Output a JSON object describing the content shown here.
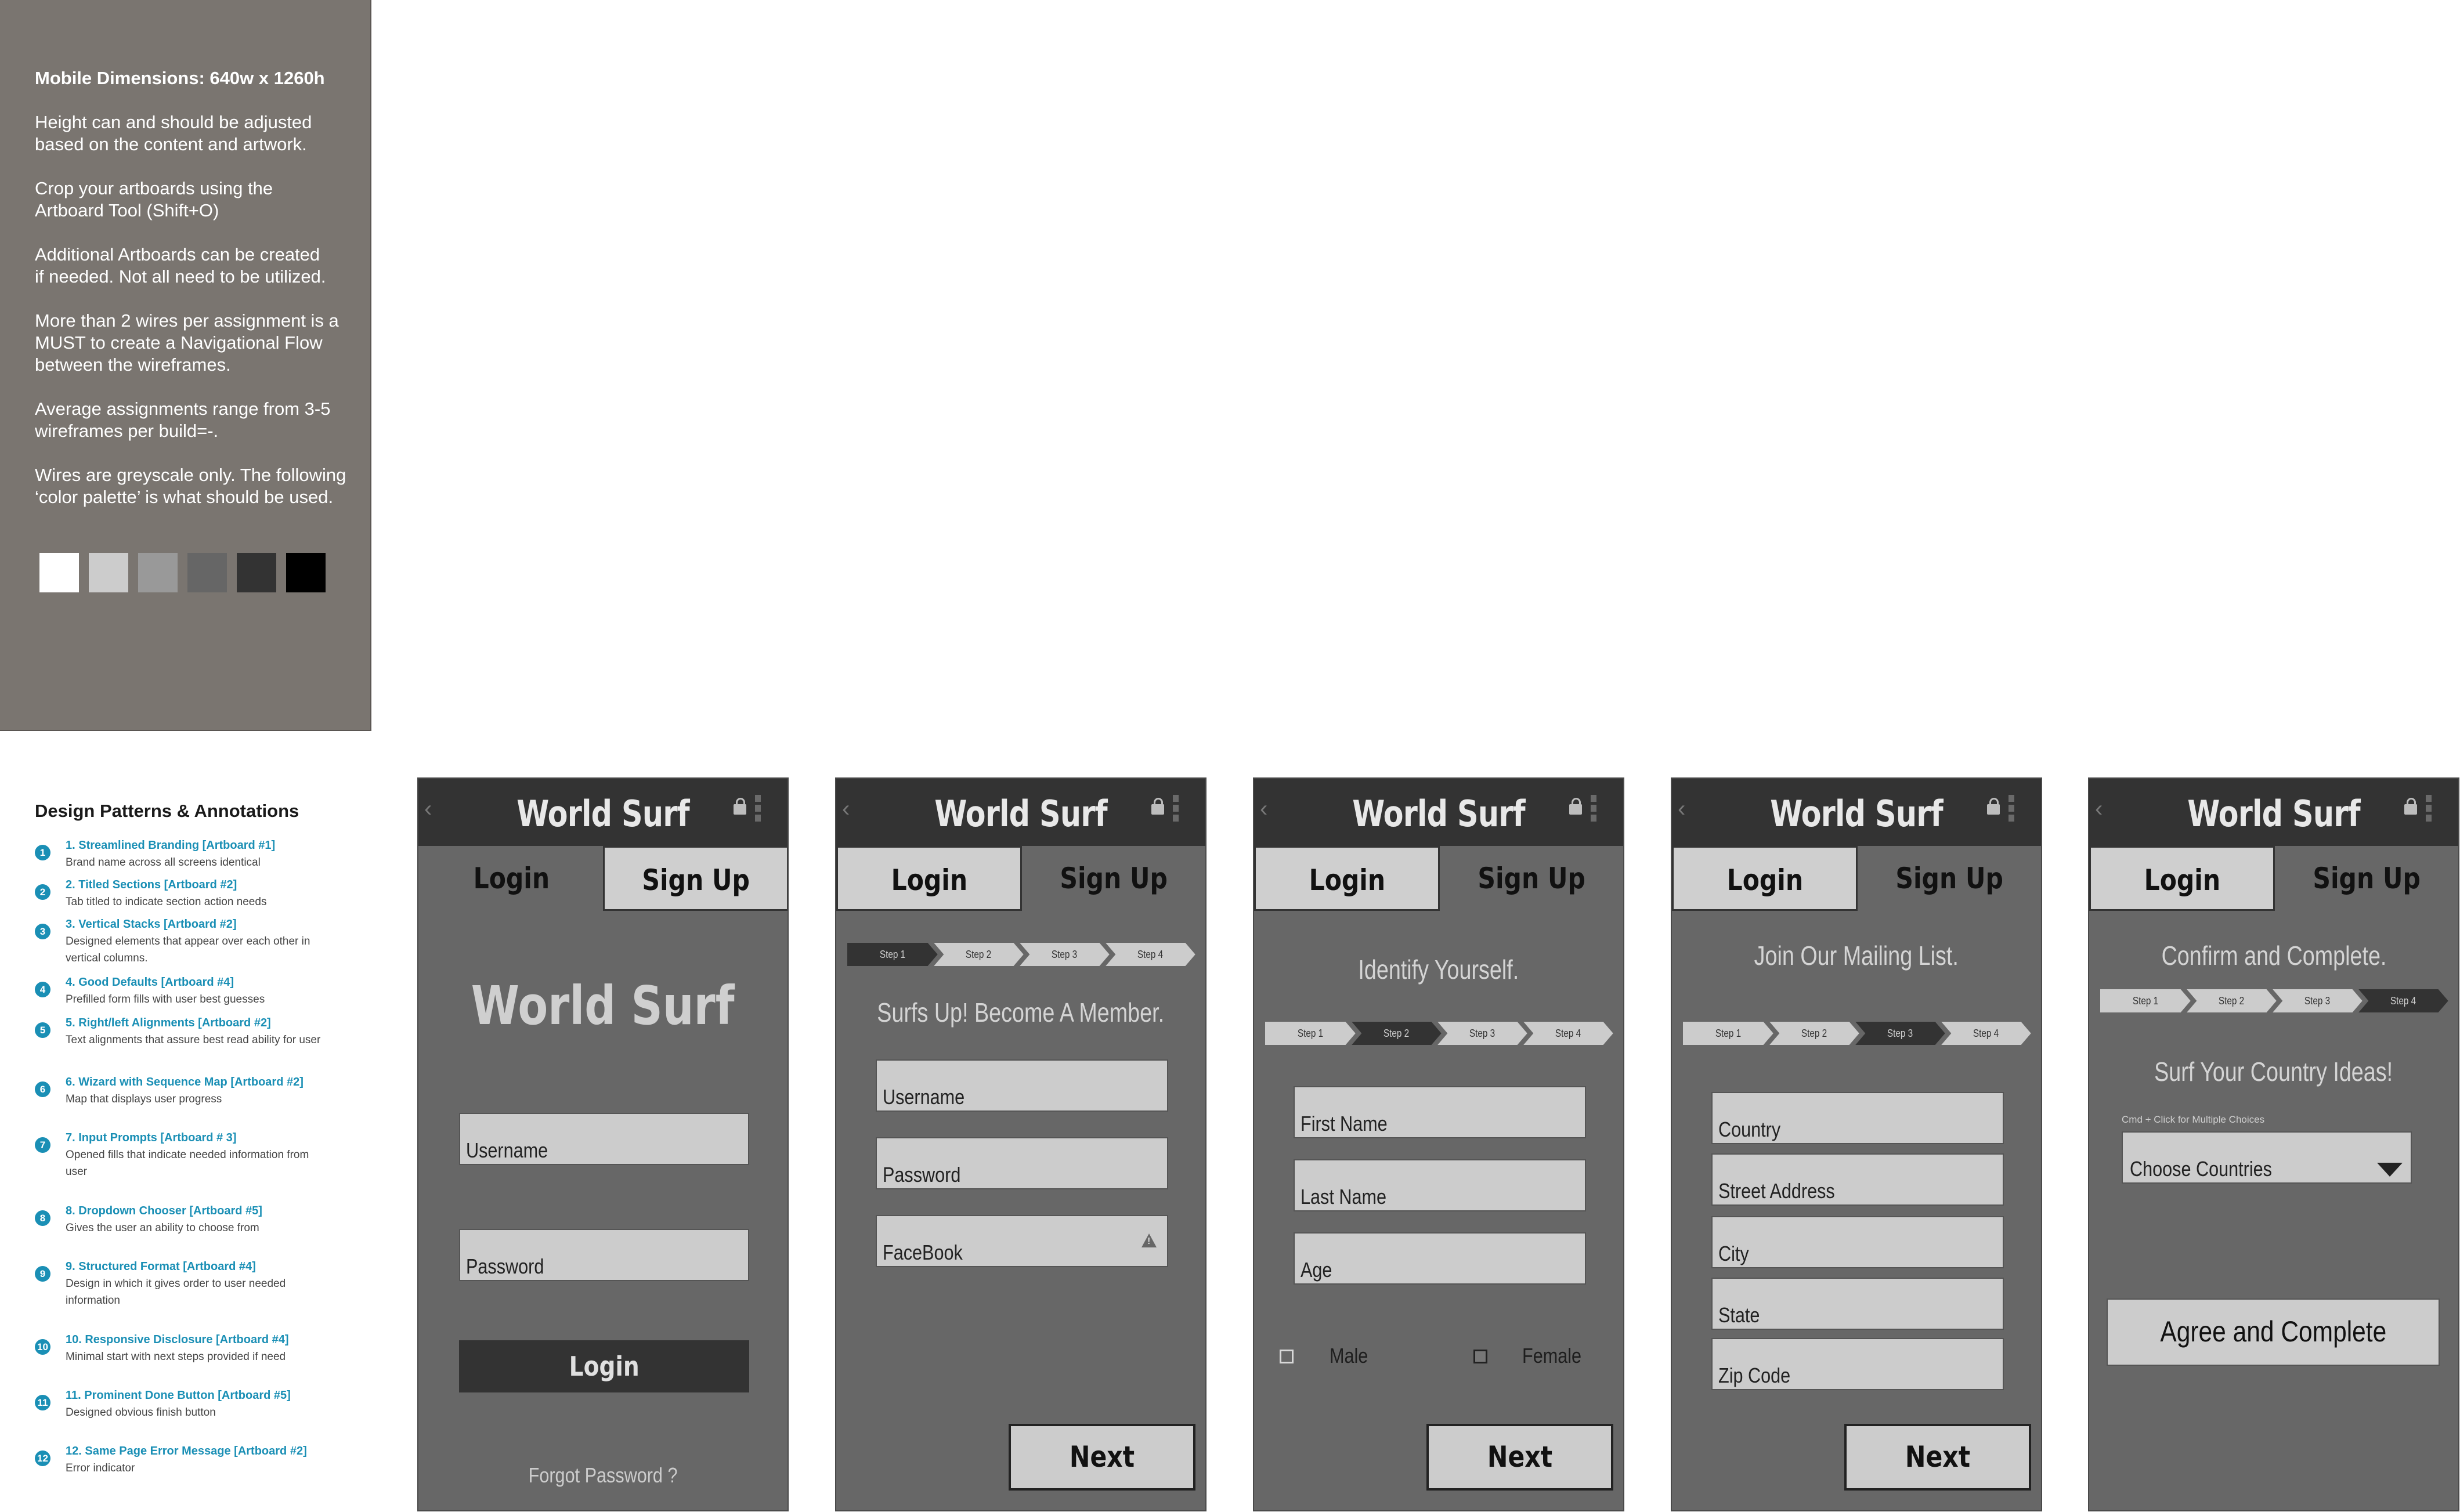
{
  "info_panel": {
    "paragraphs": [
      "Mobile Dimensions: 640w x 1260h",
      "Height can and should be adjusted\nbased on the content and artwork.",
      "Crop your artboards using the\nArtboard Tool  (Shift+O)",
      "Additional Artboards can be created\nif needed. Not all need to be utilized.",
      "More than 2 wires per assignment is a\nMUST to create a Navigational Flow\nbetween the wireframes.",
      "Average assignments range from 3-5\nwireframes per build=-.",
      "Wires are greyscale only. The following\n‘color palette’ is what should be used."
    ],
    "palette": [
      "#ffffff",
      "#cccccc",
      "#999999",
      "#666666",
      "#333333",
      "#000000"
    ]
  },
  "annotations": {
    "title": "Design Patterns & Annotations",
    "items": [
      {
        "num": "1",
        "title": "1. Streamlined Branding [Artboard #1]",
        "desc": "Brand name across all screens identical"
      },
      {
        "num": "2",
        "title": "2. Titled Sections [Artboard #2]",
        "desc": "Tab titled to indicate section action needs"
      },
      {
        "num": "3",
        "title": "3. Vertical Stacks [Artboard #2]",
        "desc": "Designed elements that appear over each other in vertical columns."
      },
      {
        "num": "4",
        "title": "4. Good Defaults [Artboard #4]",
        "desc": "Prefilled form fills with user best guesses"
      },
      {
        "num": "5",
        "title": "5. Right/left Alignments [Artboard #2]",
        "desc": "Text alignments that assure best read ability for user"
      },
      {
        "num": "6",
        "title": "6. Wizard with Sequence Map [Artboard #2]",
        "desc": "Map that displays user progress"
      },
      {
        "num": "7",
        "title": "7. Input Prompts [Artboard # 3]",
        "desc": "Opened fills that indicate needed information from user"
      },
      {
        "num": "8",
        "title": "8. Dropdown Chooser [Artboard #5]",
        "desc": "Gives the user an ability to choose from"
      },
      {
        "num": "9",
        "title": "9. Structured Format [Artboard #4]",
        "desc": "Design in which it gives order to user needed information"
      },
      {
        "num": "10",
        "title": "10. Responsive Disclosure [Artboard #4]",
        "desc": "Minimal start with next steps provided if need"
      },
      {
        "num": "11",
        "title": "11. Prominent Done Button [Artboard #5]",
        "desc": "Designed obvious finish button"
      },
      {
        "num": "12",
        "title": "12. Same Page Error Message [Artboard #2]",
        "desc": "Error indicator"
      }
    ]
  },
  "app": {
    "brand": "World Surf",
    "tab_login": "Login",
    "tab_signup": "Sign Up",
    "steps": [
      "Step 1",
      "Step 2",
      "Step 3",
      "Step 4"
    ],
    "next_label": "Next"
  },
  "board1": {
    "big_brand": "World Surf",
    "username": "Username",
    "password": "Password",
    "login_button": "Login",
    "forgot": "Forgot Password ?"
  },
  "board2": {
    "heading": "Surfs Up!  Become A Member.",
    "username": "Username",
    "password": "Password",
    "facebook": "FaceBook"
  },
  "board3": {
    "heading": "Identify Yourself.",
    "first_name": "First Name",
    "last_name": "Last Name",
    "age": "Age",
    "male": "Male",
    "female": "Female"
  },
  "board4": {
    "heading": "Join Our Mailing List.",
    "country": "Country",
    "street": "Street Address",
    "city": "City",
    "state": "State",
    "zip": "Zip Code"
  },
  "board5": {
    "heading": "Confirm and Complete.",
    "subheading": "Surf Your Country Ideas!",
    "hint": "Cmd + Click for Multiple Choices",
    "select": "Choose Countries",
    "agree_button": "Agree and Complete"
  }
}
